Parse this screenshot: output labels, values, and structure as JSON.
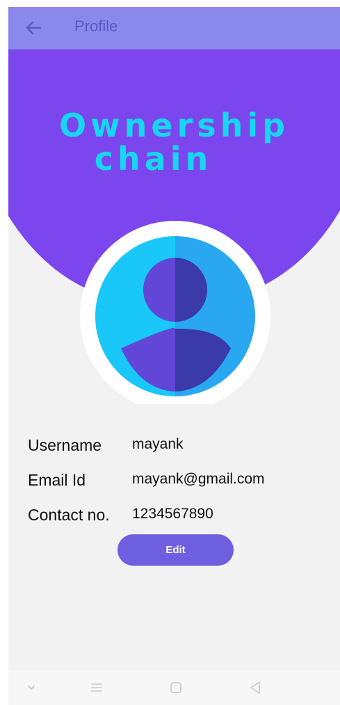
{
  "appbar": {
    "title": "Profile",
    "back_icon": "arrow-left-icon"
  },
  "header": {
    "logo_line1": "Ownership",
    "logo_line2": "chain"
  },
  "avatar": {
    "icon": "user-avatar-icon"
  },
  "profile": {
    "username_label": "Username",
    "username_value": "mayank",
    "email_label": "Email Id",
    "email_value": "mayank@gmail.com",
    "contact_label": "Contact no.",
    "contact_value": "1234567890"
  },
  "actions": {
    "edit_label": "Edit"
  },
  "navbar": {
    "icons": [
      "chevron-down-icon",
      "menu-icon",
      "home-square-icon",
      "back-triangle-icon"
    ]
  },
  "colors": {
    "appbar": "#8b88ec",
    "header": "#7b46ee",
    "accent": "#17d6f0",
    "button": "#6e5fe0",
    "background": "#f2f2f2"
  }
}
